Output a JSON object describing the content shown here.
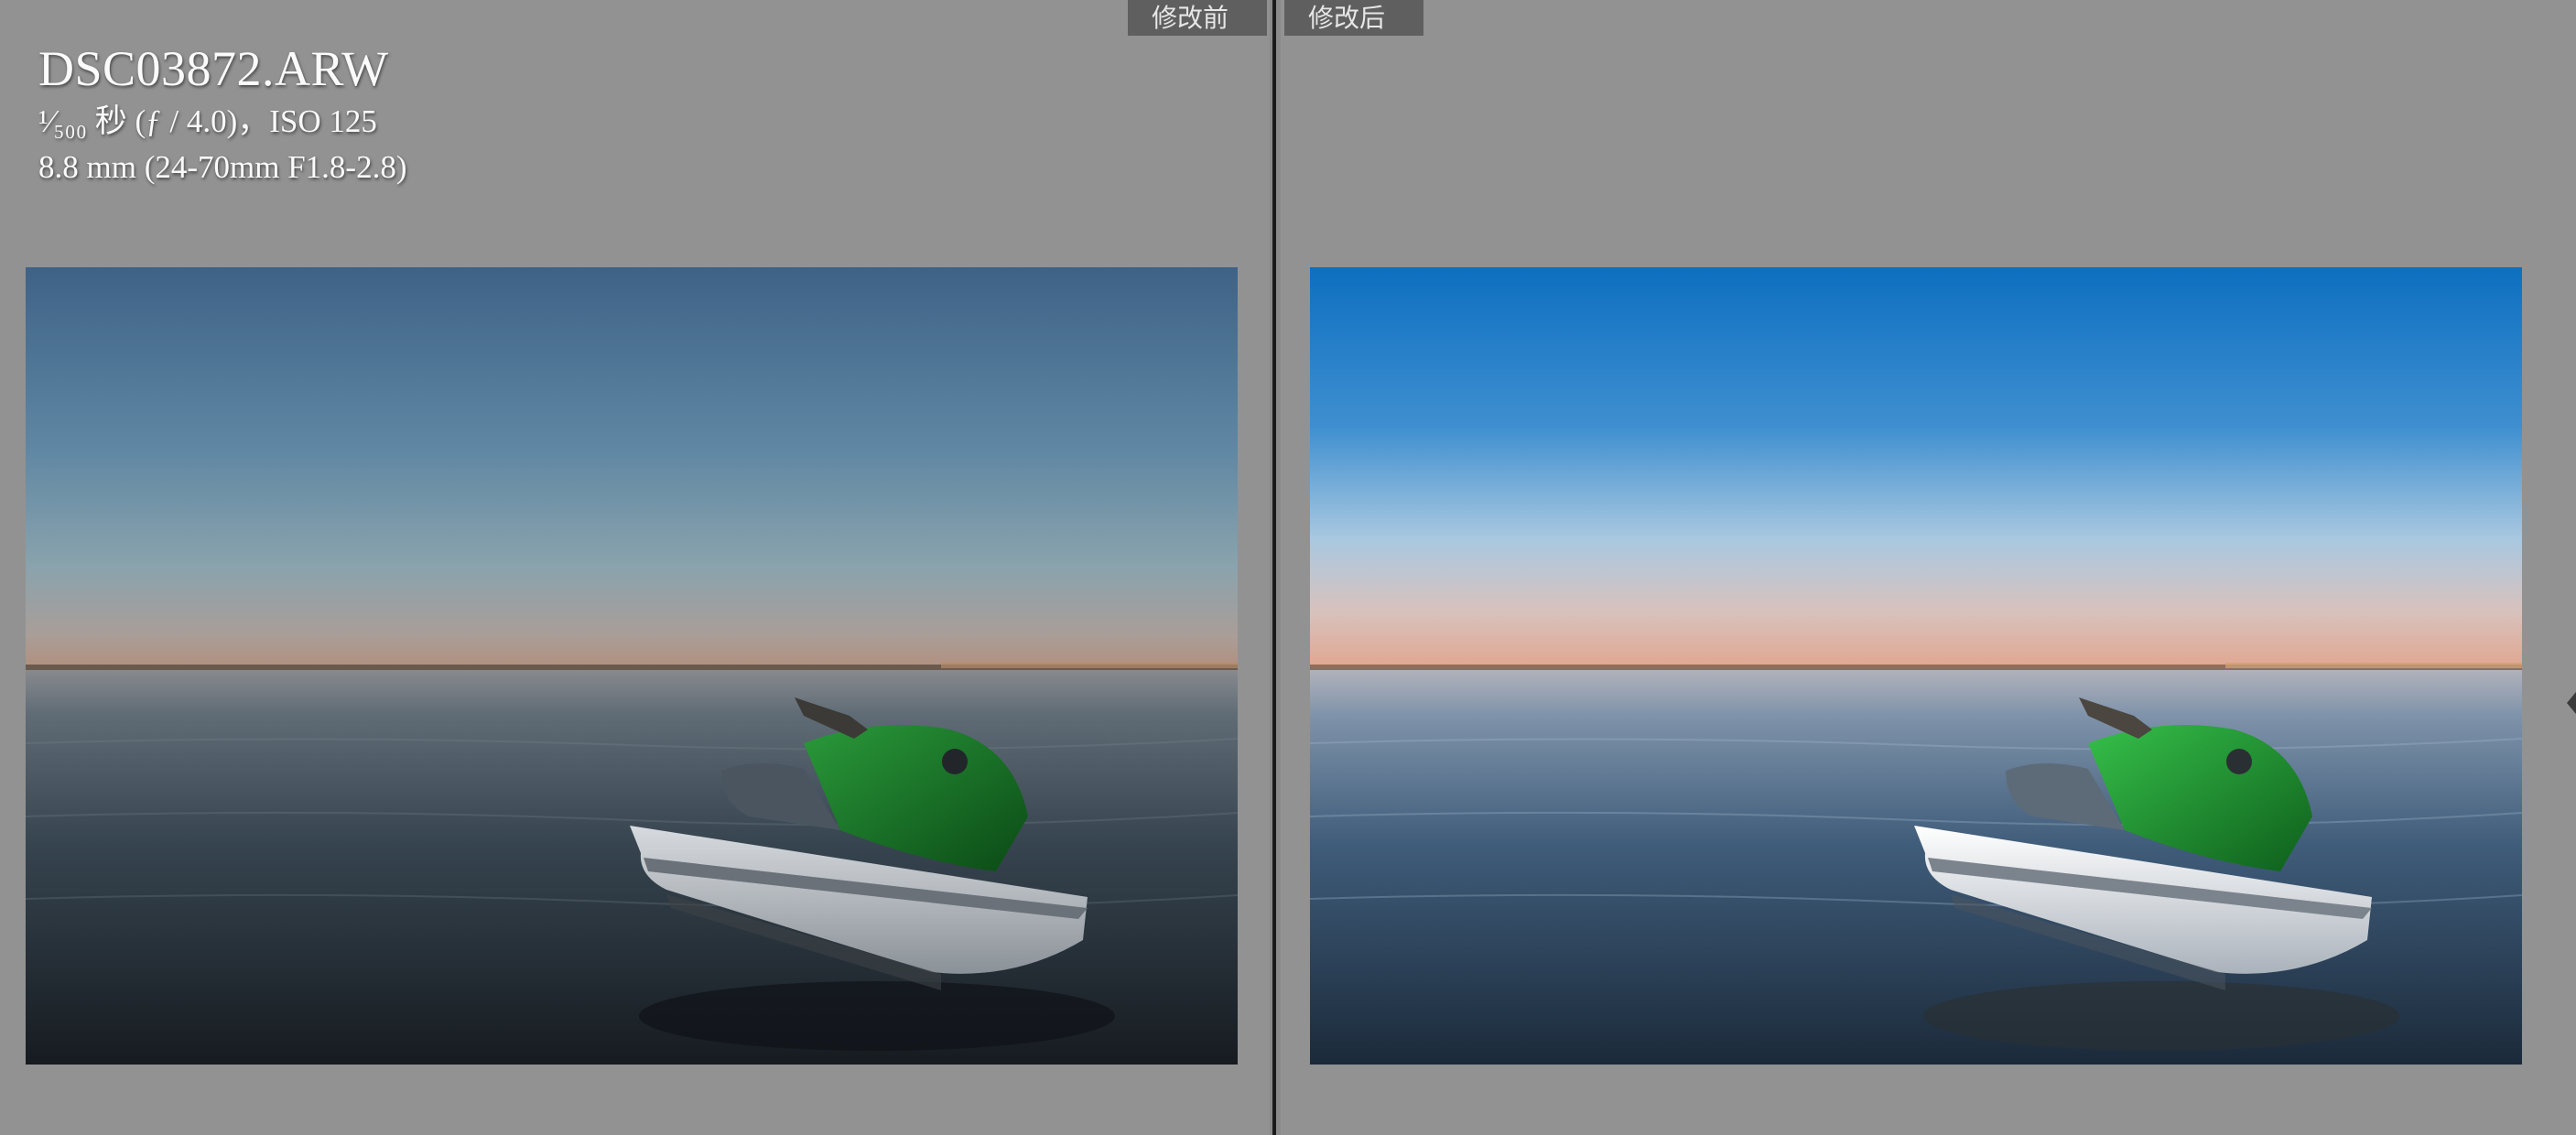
{
  "view_tabs": {
    "before_label": "修改前",
    "after_label": "修改后"
  },
  "photo_info": {
    "filename": "DSC03872.ARW",
    "exposure": "¹⁄₅₀₀ 秒 (ƒ / 4.0)，ISO 125",
    "lens": "8.8 mm (24-70mm F1.8-2.8)"
  },
  "colors": {
    "panel_background": "#929292",
    "before_sky_top": "#3e6287",
    "after_sky_top": "#0d6fc0",
    "jetski_green": "#1f8a2c"
  },
  "icons": {
    "right_edge": "chevron-left-icon"
  }
}
